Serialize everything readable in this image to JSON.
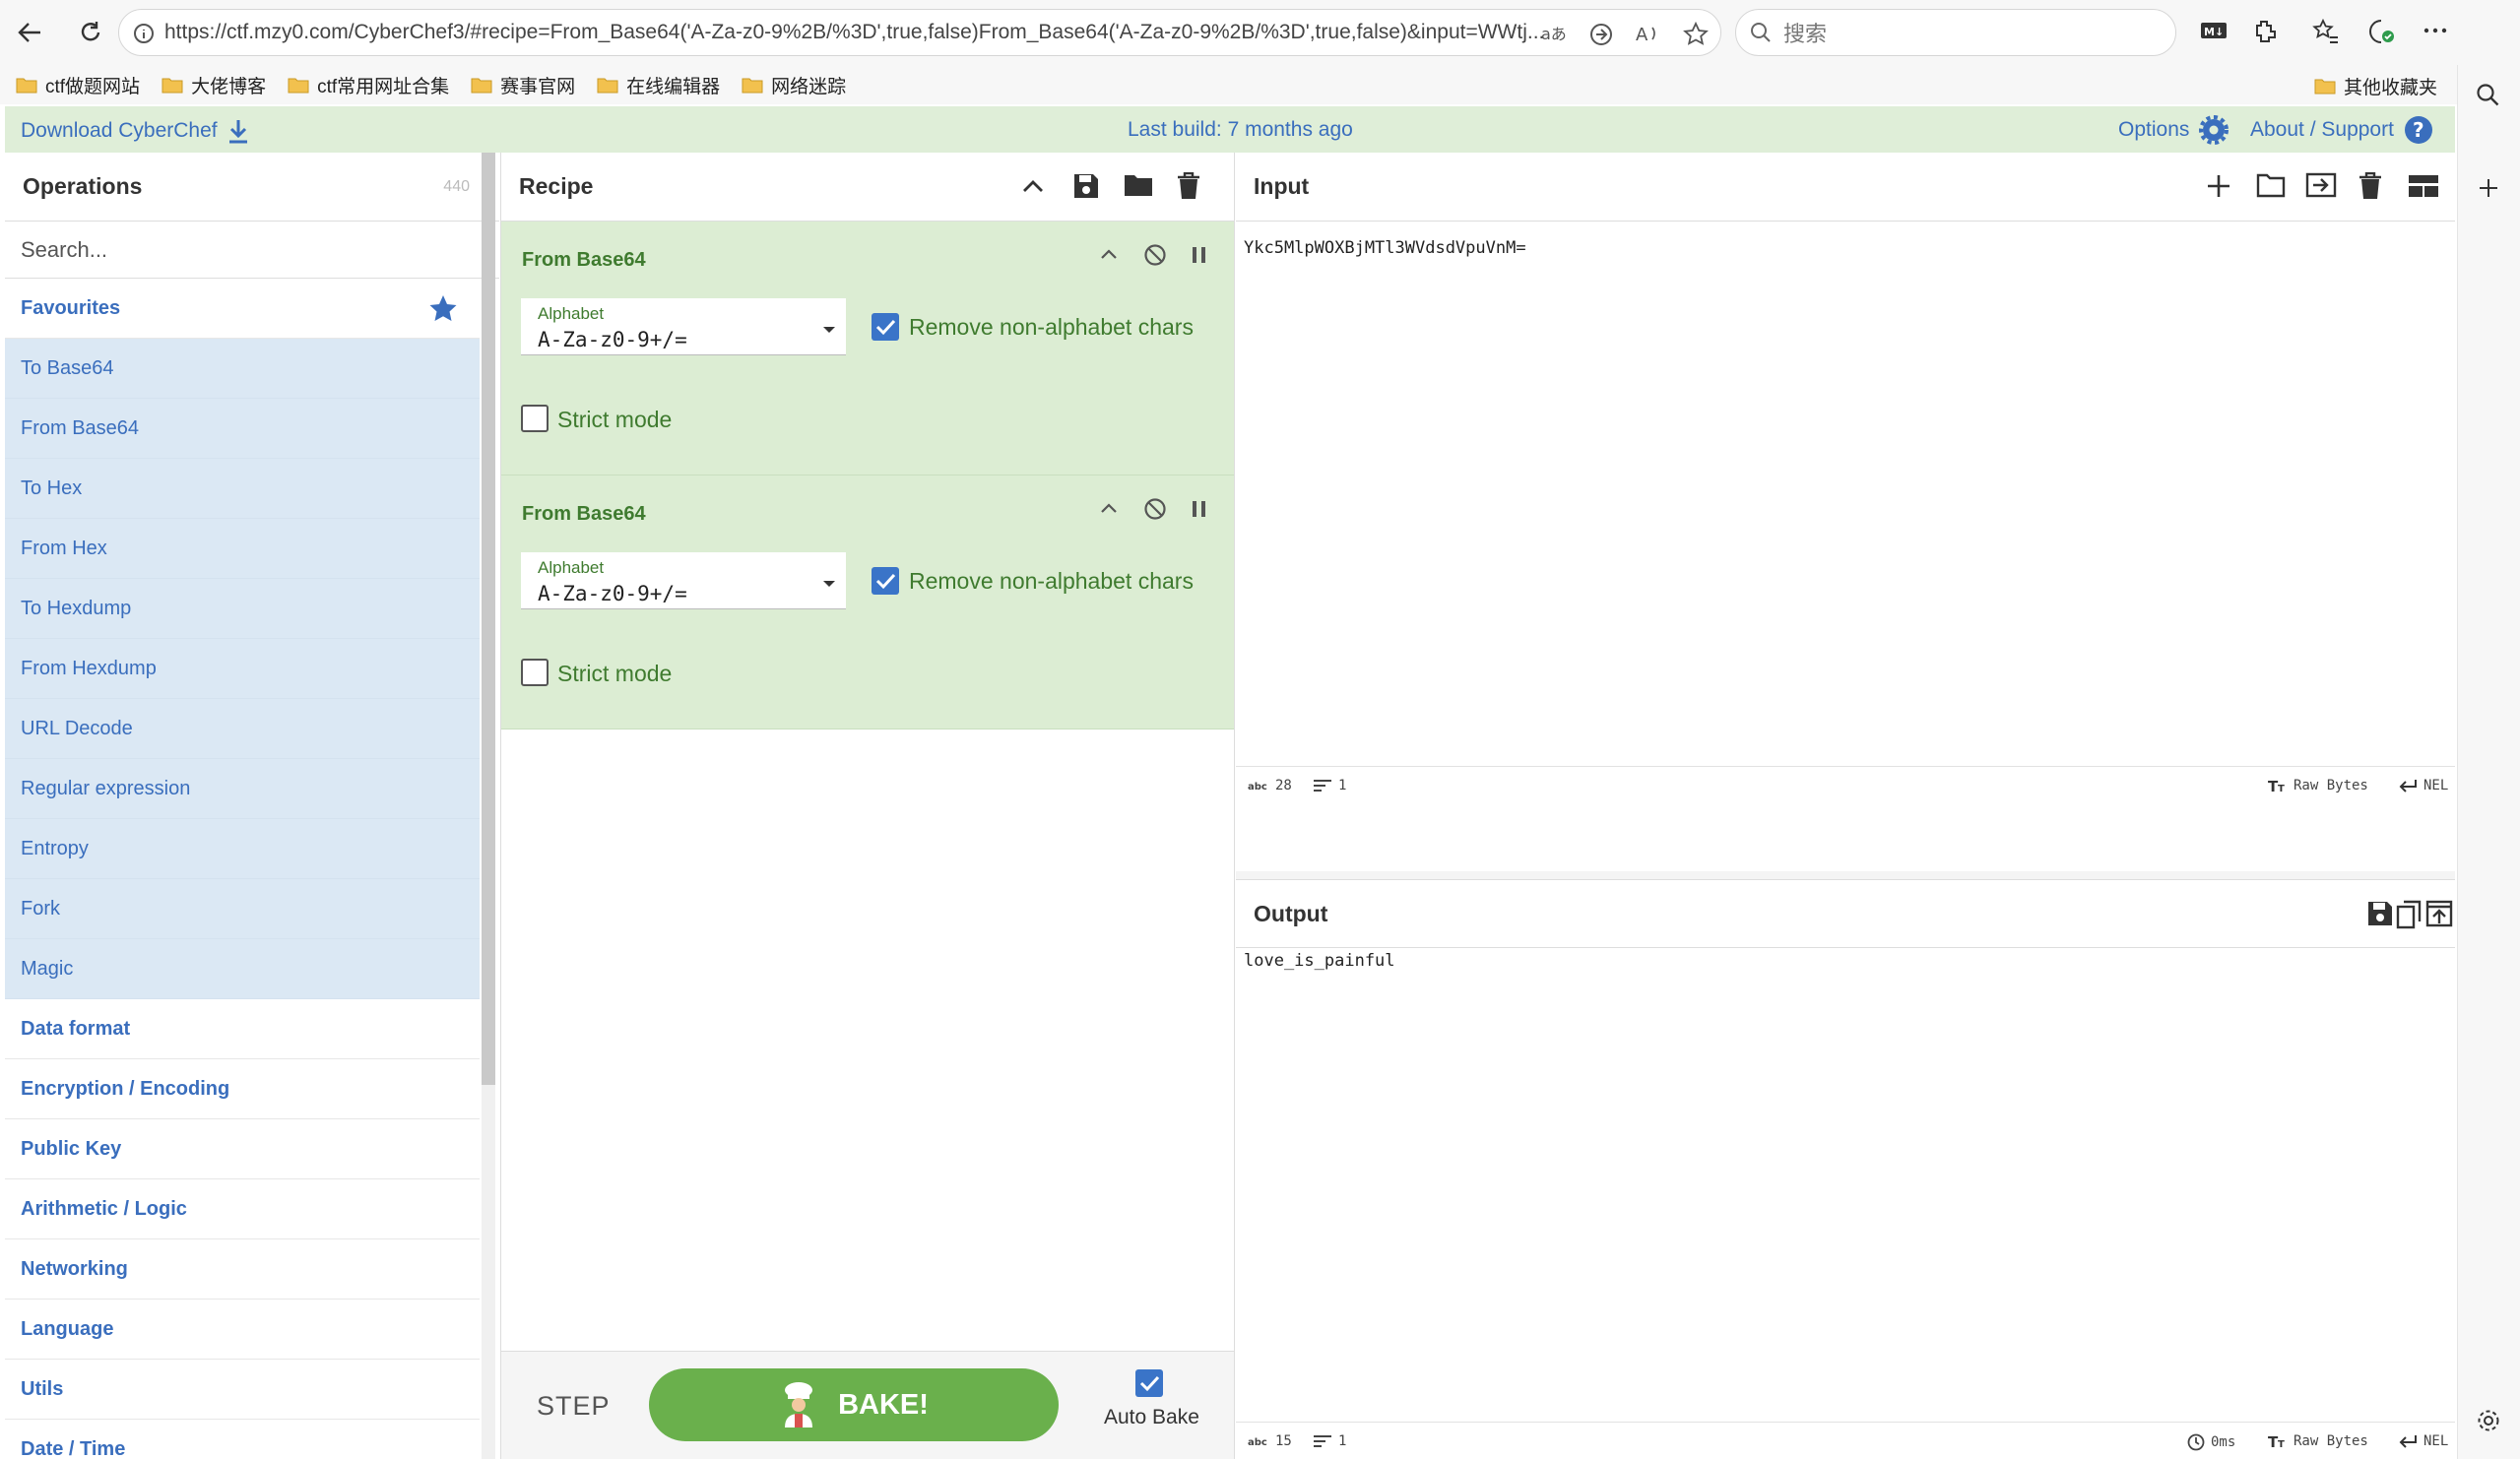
{
  "browser": {
    "url": "https://ctf.mzy0.com/CyberChef3/#recipe=From_Base64('A-Za-z0-9%2B/%3D',true,false)From_Base64('A-Za-z0-9%2B/%3D',true,false)&input=WWtj...",
    "search_placeholder": "搜索",
    "bookmarks": [
      "ctf做题网站",
      "大佬博客",
      "ctf常用网址合集",
      "赛事官网",
      "在线编辑器",
      "网络迷踪"
    ],
    "other_bookmarks": "其他收藏夹"
  },
  "banner": {
    "download": "Download CyberChef",
    "last_build": "Last build: 7 months ago",
    "options": "Options",
    "about": "About / Support"
  },
  "operations": {
    "title": "Operations",
    "count": "440",
    "search_placeholder": "Search...",
    "favourites_label": "Favourites",
    "favourites": [
      "To Base64",
      "From Base64",
      "To Hex",
      "From Hex",
      "To Hexdump",
      "From Hexdump",
      "URL Decode",
      "Regular expression",
      "Entropy",
      "Fork",
      "Magic"
    ],
    "categories": [
      "Data format",
      "Encryption / Encoding",
      "Public Key",
      "Arithmetic / Logic",
      "Networking",
      "Language",
      "Utils",
      "Date / Time"
    ]
  },
  "recipe": {
    "title": "Recipe",
    "ops": [
      {
        "name": "From Base64",
        "alphabet_label": "Alphabet",
        "alphabet": "A-Za-z0-9+/=",
        "remove_label": "Remove non-alphabet chars",
        "remove_checked": true,
        "strict_label": "Strict mode",
        "strict_checked": false
      },
      {
        "name": "From Base64",
        "alphabet_label": "Alphabet",
        "alphabet": "A-Za-z0-9+/=",
        "remove_label": "Remove non-alphabet chars",
        "remove_checked": true,
        "strict_label": "Strict mode",
        "strict_checked": false
      }
    ],
    "step_label": "STEP",
    "bake_label": "BAKE!",
    "autobake_label": "Auto Bake"
  },
  "input": {
    "title": "Input",
    "text": "Ykc5MlpWOXBjMTl3WVdsdVpuVnM=",
    "length": "28",
    "lines": "1",
    "encoding": "Raw Bytes",
    "eol": "NEL"
  },
  "output": {
    "title": "Output",
    "text": "love_is_painful",
    "length": "15",
    "lines": "1",
    "time": "0ms",
    "encoding": "Raw Bytes",
    "eol": "NEL"
  },
  "colors": {
    "accent_blue": "#3a6ebd",
    "recipe_green": "#dcedd3",
    "bake_green": "#6ab04c",
    "favourite_bg": "#dbe8f4"
  }
}
